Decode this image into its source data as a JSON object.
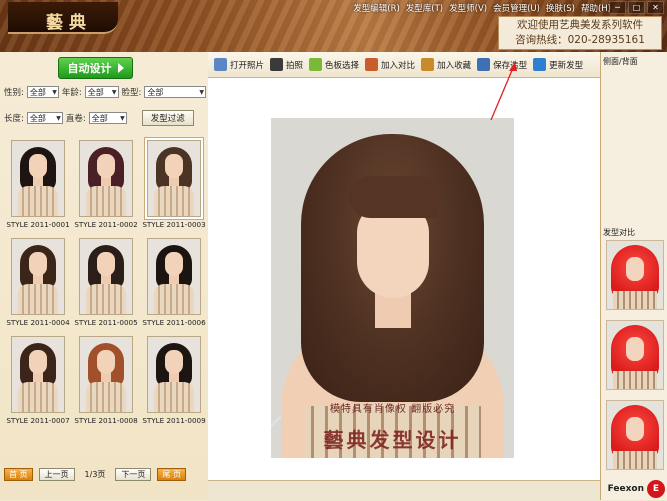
{
  "app": {
    "logo_text": "藝典",
    "menu": [
      "发型编辑(R)",
      "发型库(T)",
      "发型师(V)",
      "会员管理(U)",
      "换肤(S)",
      "帮助(H)"
    ],
    "welcome_line1": "欢迎使用艺典美发系列软件",
    "welcome_line2": "咨询热线：020-28935161"
  },
  "left": {
    "auto_design": "自动设计",
    "filters": {
      "gender_label": "性别:",
      "gender_value": "全部",
      "age_label": "年龄:",
      "age_value": "全部",
      "face_label": "脸型:",
      "face_value": "全部",
      "length_label": "长度:",
      "length_value": "全部",
      "curl_label": "直卷:",
      "curl_value": "全部",
      "filter_button": "发型过滤"
    },
    "styles": [
      {
        "label": "STYLE 2011-0001",
        "hair_color": "#1e1512"
      },
      {
        "label": "STYLE 2011-0002",
        "hair_color": "#4a1f25"
      },
      {
        "label": "STYLE 2011-0003",
        "hair_color": "#4b3426"
      },
      {
        "label": "STYLE 2011-0004",
        "hair_color": "#3a2518"
      },
      {
        "label": "STYLE 2011-0005",
        "hair_color": "#2b1d18"
      },
      {
        "label": "STYLE 2011-0006",
        "hair_color": "#1b1411"
      },
      {
        "label": "STYLE 2011-0007",
        "hair_color": "#3b251b"
      },
      {
        "label": "STYLE 2011-0008",
        "hair_color": "#a2502b"
      },
      {
        "label": "STYLE 2011-0009",
        "hair_color": "#1c1512"
      }
    ],
    "pager": {
      "first": "首 页",
      "prev": "上一页",
      "page_info": "1/3页",
      "next": "下一页",
      "last": "尾 页"
    }
  },
  "toolbar": [
    {
      "label": "打开照片",
      "icon": "open-photo-icon",
      "color": "#5d86c5"
    },
    {
      "label": "拍照",
      "icon": "camera-icon",
      "color": "#3a3a3a"
    },
    {
      "label": "色板选择",
      "icon": "palette-icon",
      "color": "#7ab83a"
    },
    {
      "label": "加入对比",
      "icon": "compare-icon",
      "color": "#c95d2b"
    },
    {
      "label": "加入收藏",
      "icon": "favorite-icon",
      "color": "#c98a2b"
    },
    {
      "label": "保存造型",
      "icon": "save-icon",
      "color": "#3f6fb5"
    },
    {
      "label": "更新发型",
      "icon": "refresh-icon",
      "color": "#2f7fd1"
    }
  ],
  "canvas": {
    "watermark_line1": "模特具有肖像权   翻版必究",
    "watermark_line2": "藝典发型设计"
  },
  "right": {
    "side_back": "侧面/背面",
    "compare": "发型对比"
  },
  "brand": {
    "text": "Feexon",
    "icon_text": "E"
  },
  "colors": {
    "accent": "#d91b1b",
    "auto_green": "#1f9a1b",
    "arrow": "#e02020"
  }
}
